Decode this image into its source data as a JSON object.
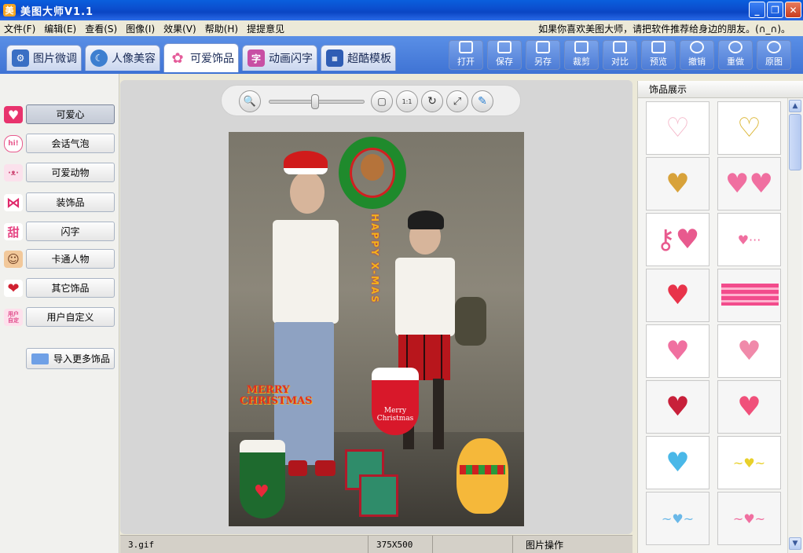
{
  "window": {
    "title": "美图大师V1.1",
    "app_icon": "美",
    "minimize": "_",
    "restore": "❐",
    "close": "✕"
  },
  "menubar": {
    "items": [
      "文件(F)",
      "编辑(E)",
      "查看(S)",
      "图像(I)",
      "效果(V)",
      "帮助(H)",
      "提提意见"
    ],
    "tip": "如果你喜欢美图大师，请把软件推荐给身边的朋友。(∩_∩)。"
  },
  "tabs": [
    {
      "label": "图片微调",
      "icon": "adjust-icon",
      "color": "#3a6fc4",
      "active": false
    },
    {
      "label": "人像美容",
      "icon": "portrait-icon",
      "color": "#3d7fd0",
      "active": false
    },
    {
      "label": "可爱饰品",
      "icon": "flower-icon",
      "color": "#e55c9a",
      "active": true
    },
    {
      "label": "动画闪字",
      "icon": "text-char-icon",
      "color": "#c84fa4",
      "active": false
    },
    {
      "label": "超酷模板",
      "icon": "cool-template-icon",
      "color": "#2f5db4",
      "active": false
    }
  ],
  "tab_char": "字",
  "toolbar": [
    {
      "label": "打开",
      "icon": "open-folder-icon"
    },
    {
      "label": "保存",
      "icon": "save-icon"
    },
    {
      "label": "另存",
      "icon": "save-as-icon"
    },
    {
      "label": "裁剪",
      "icon": "crop-icon"
    },
    {
      "label": "对比",
      "icon": "compare-icon"
    },
    {
      "label": "预览",
      "icon": "preview-icon"
    },
    {
      "label": "撤销",
      "icon": "undo-icon"
    },
    {
      "label": "重做",
      "icon": "redo-icon"
    },
    {
      "label": "原图",
      "icon": "original-icon"
    }
  ],
  "categories": [
    {
      "label": "可爱心",
      "icon": "heart-icon",
      "color": "#e8336d",
      "glyph": "♥",
      "active": true
    },
    {
      "label": "会话气泡",
      "icon": "speech-bubble-icon",
      "color": "#e85a8e",
      "glyph": "hi!",
      "active": false
    },
    {
      "label": "可爱动物",
      "icon": "bunny-icon",
      "color": "#f0a8c6",
      "glyph": "·ᴥ·",
      "active": false
    },
    {
      "label": "装饰品",
      "icon": "bow-icon",
      "color": "#e0286a",
      "glyph": "⋈",
      "active": false
    },
    {
      "label": "闪字",
      "icon": "flash-text-icon",
      "color": "#e64684",
      "glyph": "甜",
      "active": false
    },
    {
      "label": "卡通人物",
      "icon": "cartoon-girl-icon",
      "color": "#b56a3e",
      "glyph": "☺",
      "active": false
    },
    {
      "label": "其它饰品",
      "icon": "red-heart-icon",
      "color": "#d02030",
      "glyph": "❤",
      "active": false
    },
    {
      "label": "用户自定义",
      "icon": "custom-icon",
      "color": "#e04a8a",
      "glyph": "用户自定",
      "active": false
    }
  ],
  "import_button": {
    "label": "导入更多饰品",
    "icon": "import-folder-icon"
  },
  "zoom": {
    "slider_level": 0.48,
    "controls": [
      {
        "name": "zoom-magnifier-icon",
        "glyph": "🔍"
      },
      {
        "name": "fit-window-icon",
        "glyph": "▢"
      },
      {
        "name": "actual-size-icon",
        "glyph": "1:1"
      },
      {
        "name": "rotate-icon",
        "glyph": "↻"
      },
      {
        "name": "resize-icon",
        "glyph": "⤢"
      },
      {
        "name": "brush-icon",
        "glyph": "✎"
      }
    ]
  },
  "photo": {
    "stickers": {
      "merry_christmas": "MERRY CHRISTMAS",
      "happy_xmas": "HAPPY X-MAS",
      "sock_text": "Merry Christmas"
    }
  },
  "statusbar": {
    "filename": "3.gif",
    "dimensions": "375X500",
    "blank": "",
    "operation": "图片操作"
  },
  "right_panel": {
    "header": "饰品展示",
    "thumbnails": [
      {
        "name": "pink-heart-lace-thumb",
        "glyph": "♡",
        "color": "#f4b6c8"
      },
      {
        "name": "gold-glitter-heart-thumb",
        "glyph": "♡",
        "color": "#d9b22a"
      },
      {
        "name": "small-gold-heart-thumb",
        "glyph": "♥",
        "color": "#d8a23a"
      },
      {
        "name": "pink-balloon-hearts-thumb",
        "glyph": "♥♥",
        "color": "#f06fa0"
      },
      {
        "name": "heart-key-thumb",
        "glyph": "⚷♥",
        "color": "#e85a8e"
      },
      {
        "name": "heart-line-thumb",
        "glyph": "♥···",
        "color": "#f06fa0"
      },
      {
        "name": "glitter-red-heart-thumb",
        "glyph": "♥",
        "color": "#e8334a"
      },
      {
        "name": "pink-stripe-bar-thumb",
        "glyph": "",
        "color": "#f24c8c"
      },
      {
        "name": "hanging-hearts-thumb",
        "glyph": "♥",
        "color": "#f070a0"
      },
      {
        "name": "dangling-heart-thumb",
        "glyph": "♥",
        "color": "#f08aaa"
      },
      {
        "name": "heart-stack-love-thumb",
        "glyph": "♥",
        "color": "#c8203a"
      },
      {
        "name": "heart-column-thumb",
        "glyph": "♥",
        "color": "#f0507a"
      },
      {
        "name": "tiny-blue-heart-thumb",
        "glyph": "♥",
        "color": "#4ab8e8"
      },
      {
        "name": "winged-yellow-heart-thumb",
        "glyph": "~♥~",
        "color": "#e8d02a"
      },
      {
        "name": "winged-blue-heart-thumb",
        "glyph": "~♥~",
        "color": "#6ab8e8"
      },
      {
        "name": "winged-pink-heart-thumb",
        "glyph": "~♥~",
        "color": "#f06fa0"
      }
    ]
  },
  "colors": {
    "title_blue": "#0b4fcf",
    "toolbar_blue": "#4f7fd8",
    "panel_bg": "#f1f1ee",
    "canvas_bg": "#d6d6d6"
  }
}
